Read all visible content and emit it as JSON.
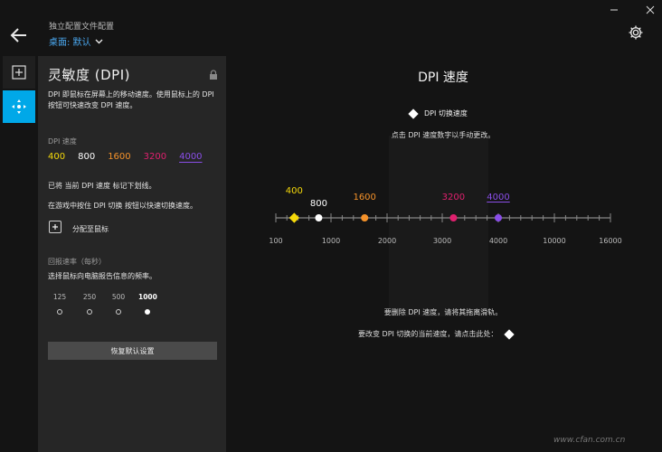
{
  "header": {
    "title": "独立配置文件配置",
    "profile": "桌面: 默认"
  },
  "panel": {
    "title": "灵敏度 (DPI)",
    "description": "DPI 即鼠标在屏幕上的移动速度。使用鼠标上的 DPI 按钮可快速改变 DPI 速度。",
    "dpi_speed_label": "DPI 速度",
    "dpi_levels": [
      {
        "value": "400",
        "color": "#f5d90a"
      },
      {
        "value": "800",
        "color": "#ffffff"
      },
      {
        "value": "1600",
        "color": "#f5922a"
      },
      {
        "value": "3200",
        "color": "#e0206e"
      },
      {
        "value": "4000",
        "color": "#8a4ee8"
      }
    ],
    "note_current": "已将 当前 DPI 速度 标记下划线。",
    "note_shift": "在游戏中按住 DPI 切换 按钮以快速切换速度。",
    "assign_label": "分配至鼠标",
    "report_rate_label": "回报速率（每秒）",
    "report_rate_desc": "选择鼠标向电脑报告信息的频率。",
    "report_rates": [
      "125",
      "250",
      "500",
      "1000"
    ],
    "report_rate_selected": "1000",
    "reset_label": "恢复默认设置"
  },
  "main": {
    "title": "DPI 速度",
    "dpi_shift_label": "DPI 切换速度",
    "hint": "点击 DPI 速度数字以手动更改。",
    "axis_ticks": [
      "100",
      "1000",
      "2000",
      "3000",
      "4000",
      "10000",
      "16000"
    ],
    "stages": [
      {
        "value": "400",
        "color": "#f5d90a"
      },
      {
        "value": "800",
        "color": "#ffffff"
      },
      {
        "value": "1600",
        "color": "#f5922a"
      },
      {
        "value": "3200",
        "color": "#e0206e"
      },
      {
        "value": "4000",
        "color": "#8a4ee8"
      }
    ],
    "delete_hint": "要删除 DPI 速度，请将其拖离滑轨。",
    "change_hint": "要改变 DPI 切换的当前速度，请点击此处："
  },
  "watermark": "www.cfan.com.cn",
  "colors": {
    "accent": "#00a8e8",
    "link": "#4aa8f0"
  }
}
